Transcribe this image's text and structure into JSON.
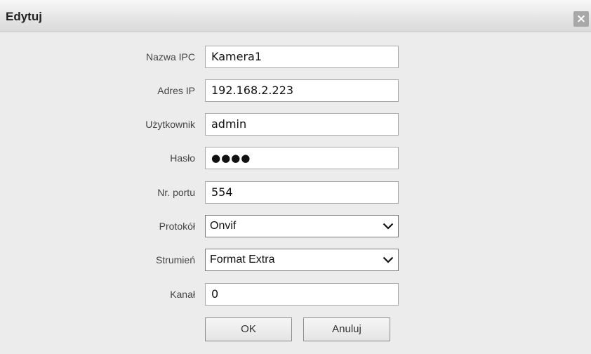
{
  "dialog": {
    "title": "Edytuj",
    "close_glyph": "×"
  },
  "form": {
    "ipc_name": {
      "label": "Nazwa IPC",
      "value": "Kamera1"
    },
    "ip_address": {
      "label": "Adres IP",
      "value": "192.168.2.223"
    },
    "user": {
      "label": "Użytkownik",
      "value": "admin"
    },
    "password": {
      "label": "Hasło",
      "value": "●●●●"
    },
    "port": {
      "label": "Nr. portu",
      "value": "554"
    },
    "protocol": {
      "label": "Protokół",
      "selected": "Onvif"
    },
    "stream": {
      "label": "Strumień",
      "selected": "Format Extra"
    },
    "channel": {
      "label": "Kanał",
      "value": "0"
    }
  },
  "buttons": {
    "ok_label": "OK",
    "cancel_label": "Anuluj"
  },
  "icons": {
    "close": "close-icon",
    "dropdown": "chevron-down-icon"
  }
}
